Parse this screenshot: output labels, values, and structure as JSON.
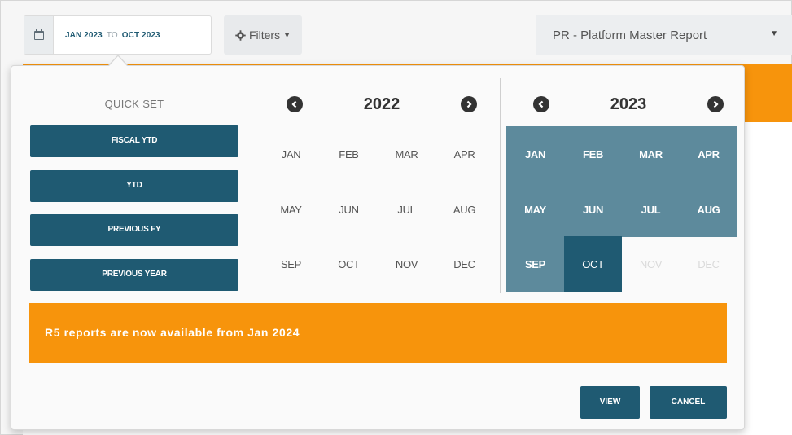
{
  "toolbar": {
    "range_start": "JAN 2023",
    "range_to": "TO",
    "range_end": "OCT 2023",
    "filters_label": "Filters",
    "report_label": "PR - Platform Master Report"
  },
  "quick_set": {
    "title": "QUICK SET",
    "buttons": [
      "FISCAL YTD",
      "YTD",
      "PREVIOUS FY",
      "PREVIOUS YEAR"
    ]
  },
  "calendars": [
    {
      "year": "2022",
      "months": [
        "JAN",
        "FEB",
        "MAR",
        "APR",
        "MAY",
        "JUN",
        "JUL",
        "AUG",
        "SEP",
        "OCT",
        "NOV",
        "DEC"
      ]
    },
    {
      "year": "2023",
      "months": [
        "JAN",
        "FEB",
        "MAR",
        "APR",
        "MAY",
        "JUN",
        "JUL",
        "AUG",
        "SEP",
        "OCT",
        "NOV",
        "DEC"
      ]
    }
  ],
  "notice": "R5 reports are now available from Jan 2024",
  "actions": {
    "view": "VIEW",
    "cancel": "CANCEL"
  },
  "colors": {
    "primary": "#1f5a72",
    "selected_range": "#5d8a9c",
    "accent": "#f7940c"
  },
  "icons": {
    "calendar": "calendar-icon",
    "gear": "gear-icon",
    "prev": "chevron-left-circle-icon",
    "next": "chevron-right-circle-icon"
  }
}
